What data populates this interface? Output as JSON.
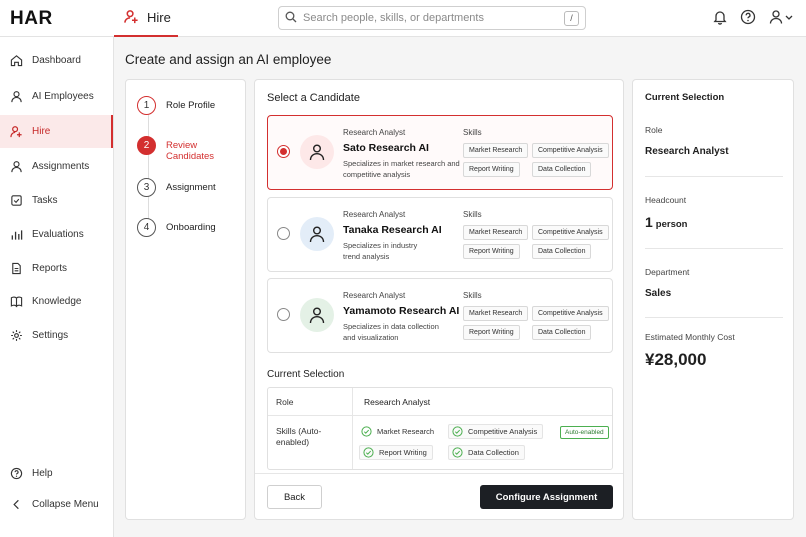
{
  "app": {
    "logo": "HAR",
    "active_tab": "Hire"
  },
  "search": {
    "placeholder": "Search people, skills, or departments",
    "shortcut": "/"
  },
  "sidebar": {
    "items": [
      {
        "label": "Dashboard",
        "icon": "home-icon"
      },
      {
        "label": "AI Employees",
        "icon": "user-icon"
      },
      {
        "label": "Hire",
        "icon": "user-plus-icon",
        "active": true
      },
      {
        "label": "Assignments",
        "icon": "user-icon"
      },
      {
        "label": "Tasks",
        "icon": "checkbox-icon"
      },
      {
        "label": "Evaluations",
        "icon": "bar-chart-icon"
      },
      {
        "label": "Reports",
        "icon": "document-icon"
      },
      {
        "label": "Knowledge",
        "icon": "book-icon"
      },
      {
        "label": "Settings",
        "icon": "gear-icon"
      }
    ],
    "help": "Help",
    "collapse": "Collapse Menu"
  },
  "page": {
    "title": "Create and assign an AI employee"
  },
  "steps": [
    {
      "num": "1",
      "label": "Role Profile"
    },
    {
      "num": "2",
      "label": "Review Candidates"
    },
    {
      "num": "3",
      "label": "Assignment"
    },
    {
      "num": "4",
      "label": "Onboarding"
    }
  ],
  "candidates_section": {
    "title": "Select a Candidate",
    "skills_label": "Skills"
  },
  "candidates": [
    {
      "role": "Research Analyst",
      "name": "Sato Research AI",
      "desc": "Specializes in market research and competitive analysis",
      "skills": [
        "Market Research",
        "Competitive Analysis",
        "Report Writing",
        "Data Collection"
      ],
      "avatar_color": "#fde8e8"
    },
    {
      "role": "Research Analyst",
      "name": "Tanaka Research AI",
      "desc": "Specializes in industry trend analysis",
      "skills": [
        "Market Research",
        "Competitive Analysis",
        "Report Writing",
        "Data Collection"
      ],
      "avatar_color": "#e3edf8"
    },
    {
      "role": "Research Analyst",
      "name": "Yamamoto Research AI",
      "desc": "Specializes in data collection and visualization",
      "skills": [
        "Market Research",
        "Competitive Analysis",
        "Report Writing",
        "Data Collection"
      ],
      "avatar_color": "#e4f1e6"
    }
  ],
  "current_selection": {
    "title": "Current Selection",
    "role_label": "Role",
    "role_value": "Research Analyst",
    "skills_label": "Skills (Auto-enabled)",
    "skills": [
      "Market Research",
      "Competitive Analysis",
      "Report Writing",
      "Data Collection"
    ],
    "badge": "Auto-enabled"
  },
  "buttons": {
    "back": "Back",
    "configure": "Configure Assignment"
  },
  "summary": {
    "title": "Current Selection",
    "role_label": "Role",
    "role_value": "Research Analyst",
    "headcount_label": "Headcount",
    "headcount_num": "1",
    "headcount_unit": "person",
    "department_label": "Department",
    "department_value": "Sales",
    "cost_label": "Estimated Monthly Cost",
    "cost_value": "¥28,000"
  },
  "colors": {
    "accent": "#d32f2f",
    "dark_button": "#1c1f24",
    "check_green": "#4caf50"
  }
}
